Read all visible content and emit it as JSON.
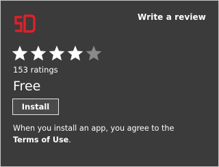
{
  "colors": {
    "background": "#3b3b3b",
    "accent": "#e0202a",
    "star_filled": "#ffffff",
    "star_empty": "#8a8a8a"
  },
  "header": {
    "logo_icon": "app-logo-icon",
    "write_review_label": "Write a review"
  },
  "rating": {
    "stars_filled": 4,
    "stars_total": 5,
    "ratings_text": "153 ratings"
  },
  "price": {
    "label": "Free"
  },
  "actions": {
    "install_label": "Install"
  },
  "notice": {
    "text": "When you install an app, you agree to the",
    "link_label": "Terms of Use",
    "suffix": "."
  }
}
